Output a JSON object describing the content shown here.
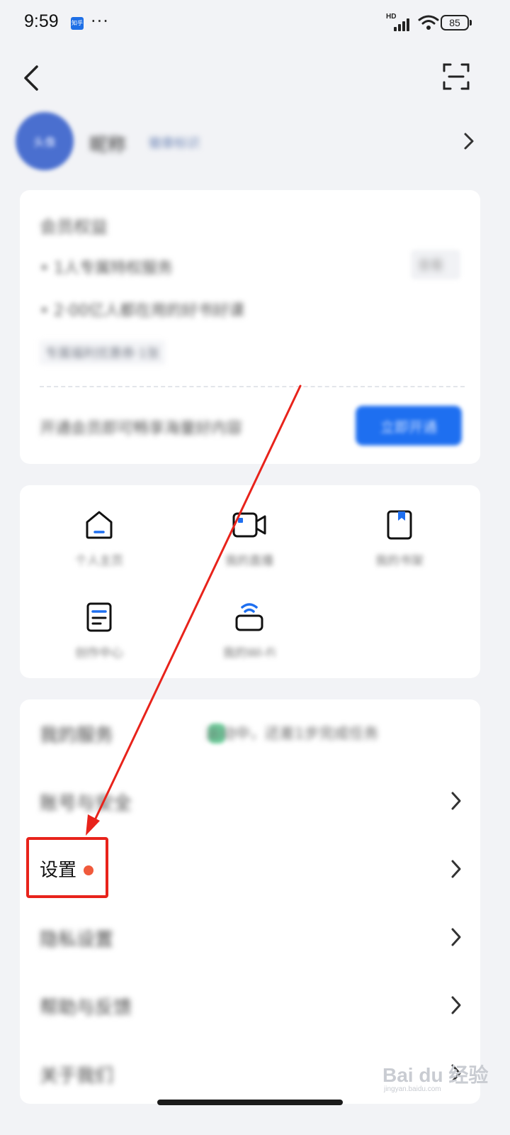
{
  "status_bar": {
    "time": "9:59",
    "app_badge": "知乎",
    "more": "···",
    "network_label": "HD",
    "battery": "85"
  },
  "profile": {
    "avatar_text": "头像",
    "name": "昵称",
    "tag": "徽章标识"
  },
  "membership": {
    "title": "会员权益",
    "line1": "• 1人专属特权服务",
    "line2": "• 2·00亿人都在用的好书好课",
    "chip": "查看",
    "tag": "专属福利优惠券·1张",
    "bottom": "开通会员即可畅享海量好内容",
    "button": "立即开通"
  },
  "shortcuts": [
    {
      "label": "个人主页",
      "icon": "home-icon"
    },
    {
      "label": "我的直播",
      "icon": "video-camera-icon"
    },
    {
      "label": "我的书架",
      "icon": "bookmark-book-icon"
    },
    {
      "label": "创作中心",
      "icon": "document-icon"
    },
    {
      "label": "我的Wi-Fi",
      "icon": "wifi-device-icon"
    }
  ],
  "list": {
    "promo_label": "我的服务",
    "promo_text": "运动中，还差1步完成任务",
    "account_security": "账号与安全",
    "settings": "设置",
    "privacy": "隐私设置",
    "help": "帮助与反馈",
    "about": "关于我们"
  },
  "watermark": {
    "text": "Bai du 经验",
    "url": "jingyan.baidu.com"
  },
  "colors": {
    "accent": "#1e6ff0",
    "highlight": "#e8231b",
    "dot": "#f05a3c",
    "background": "#f2f3f6"
  }
}
